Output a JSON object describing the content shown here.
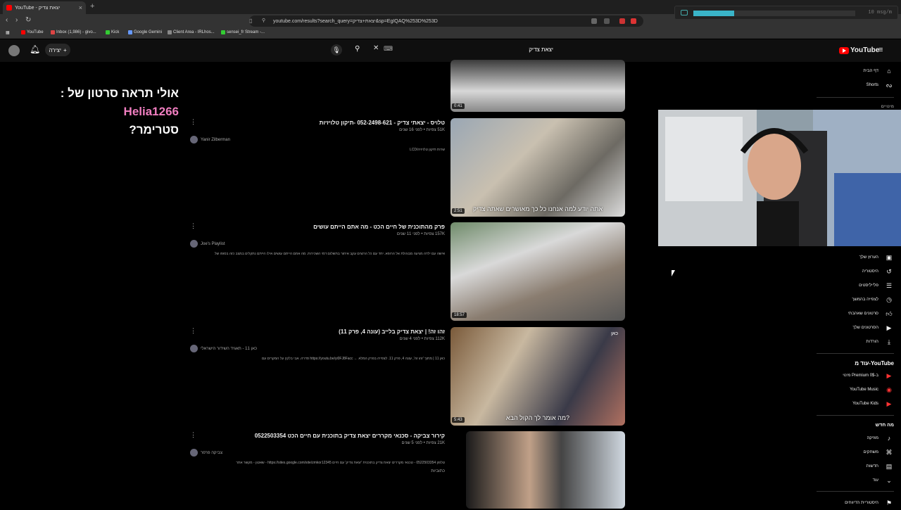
{
  "browser": {
    "tab_title": "YouTube - יצאת צדיק",
    "url": "youtube.com/results?search_query=יצאת+צדיק&sp=EgIQAQ%253D%253D",
    "bookmarks": [
      "YouTube",
      "Inbox (1,986) - givo...",
      "Kick",
      "Google Gemini",
      "Client Area - IRLhos...",
      "sensei_fr Stream -..."
    ]
  },
  "obs": {
    "status": "10 msg/m",
    "level": 0.25
  },
  "youtube": {
    "create_label": "יצירה",
    "search_value": "יצאת צדיק",
    "logo_text": "YouTube"
  },
  "overlay": {
    "line1_prefix": "אולי תראה סרטון של : ",
    "username": "Helia1266",
    "line2": "סטרימר?"
  },
  "results": [
    {
      "title": "",
      "meta": "",
      "channel": "",
      "desc": "",
      "duration": "0:41",
      "caption": ""
    },
    {
      "title": "טלויס - יצאתי צדיק - 052-2498-621 -תיקון טלויזיות",
      "meta": "51K צפיות • לפני 16 שנים",
      "channel": "Yanir Zilberman",
      "desc": "שרות תיקון טלויזיה/LCD",
      "duration": "2:51",
      "caption": "אתה יודע למה אנחנו כל כך מאושרים שאתה צדיק"
    },
    {
      "title": "פרק מהתוכנית של חיים הכט - מה אתם הייתם עושים",
      "meta": "157K צפיות • לפני 11 שנים",
      "channel": "Joe's Playlist",
      "desc": "אישה עם ילדה מגיעה מבוהלת אל הרופא. יחד עם כל הרוצים עקב איחור בתשלום דמי השכירות. מה אתם הייתם עושים אילו הייתם נתקלים במצב כזה בסופו של",
      "duration": "18:57",
      "caption": ""
    },
    {
      "title": "זהו זה! | יצאת צדיק בלייב (עונה 4, פרק 11)",
      "meta": "112K צפיות • לפני 4 שנים",
      "channel": "כאן 11 - תאגיד השידור הישראלי",
      "desc": "כאן 11 | מתוך 'זהו זה', עונה 4, פרק 11. לצפייה בפרק המלא ← https://youtu.be/yi0FJ8Facc סדרה. אבי בלקין על המקרים עם",
      "duration": "5:43",
      "caption": "מה אומר לך הקול הבא?",
      "corner": "כאן"
    },
    {
      "title": "קירור צביקה - סכנאי מקררים יצאת צדיק בתוכנית עם חיים הכט 0522503354",
      "meta": "21K צפיות • לפני 5 שנים",
      "channel": "צביקה פרפר",
      "desc": "טלפון 0522503354 - טכנאי מקררים יצאת צדיק בתוכנית 'יצאת צדיק' עם חיים https://sites.google.com/site/zmkor12345 - שאטון - מקשר אתר",
      "tag": "כתוביות",
      "duration": "",
      "caption": ""
    }
  ],
  "sidebar": {
    "top": [
      {
        "label": "דף הבית",
        "icon": "home-icon"
      },
      {
        "label": "Shorts",
        "icon": "shorts-icon"
      }
    ],
    "subs_header": "מינויים",
    "you": [
      {
        "label": "הערוץ שלך",
        "icon": "channel-icon"
      },
      {
        "label": "היסטוריה",
        "icon": "history-icon"
      },
      {
        "label": "פלייליסטים",
        "icon": "playlists-icon"
      },
      {
        "label": "לצפייה בהמשך",
        "icon": "watch-later-icon"
      },
      {
        "label": "סרטונים שאהבתי",
        "icon": "like-icon"
      },
      {
        "label": "הסרטונים שלך",
        "icon": "your-videos-icon"
      },
      {
        "label": "הורדות",
        "icon": "download-icon"
      }
    ],
    "more_header": "עוד מ-YouTube",
    "more": [
      {
        "label": "מינוי Premium ב-0$",
        "icon": "premium-icon"
      },
      {
        "label": "YouTube Music",
        "icon": "music-icon"
      },
      {
        "label": "YouTube Kids",
        "icon": "kids-icon"
      }
    ],
    "new_header": "מה חדש",
    "explore": [
      {
        "label": "מוזיקה",
        "icon": "music-note-icon"
      },
      {
        "label": "משחקים",
        "icon": "gaming-icon"
      },
      {
        "label": "חדשות",
        "icon": "news-icon"
      },
      {
        "label": "עוד",
        "icon": "chevron-down-icon"
      }
    ],
    "report": "היסטוריית הדיווחים"
  }
}
